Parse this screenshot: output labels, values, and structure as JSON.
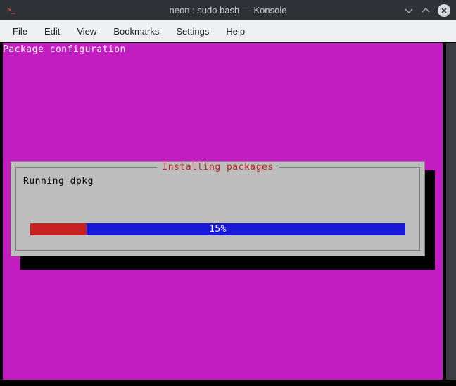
{
  "window": {
    "title": "neon : sudo bash — Konsole",
    "icon_glyph": ">_"
  },
  "menu": {
    "items": [
      "File",
      "Edit",
      "View",
      "Bookmarks",
      "Settings",
      "Help"
    ]
  },
  "terminal": {
    "header": "Package configuration",
    "dialog": {
      "title": "Installing packages",
      "status": "Running dpkg",
      "progress_percent": 15,
      "progress_label": "15%"
    }
  },
  "colors": {
    "magenta": "#c11dc1",
    "dialog_bg": "#bdbdbd",
    "progress_blue": "#1818d8",
    "progress_red": "#c62020"
  }
}
